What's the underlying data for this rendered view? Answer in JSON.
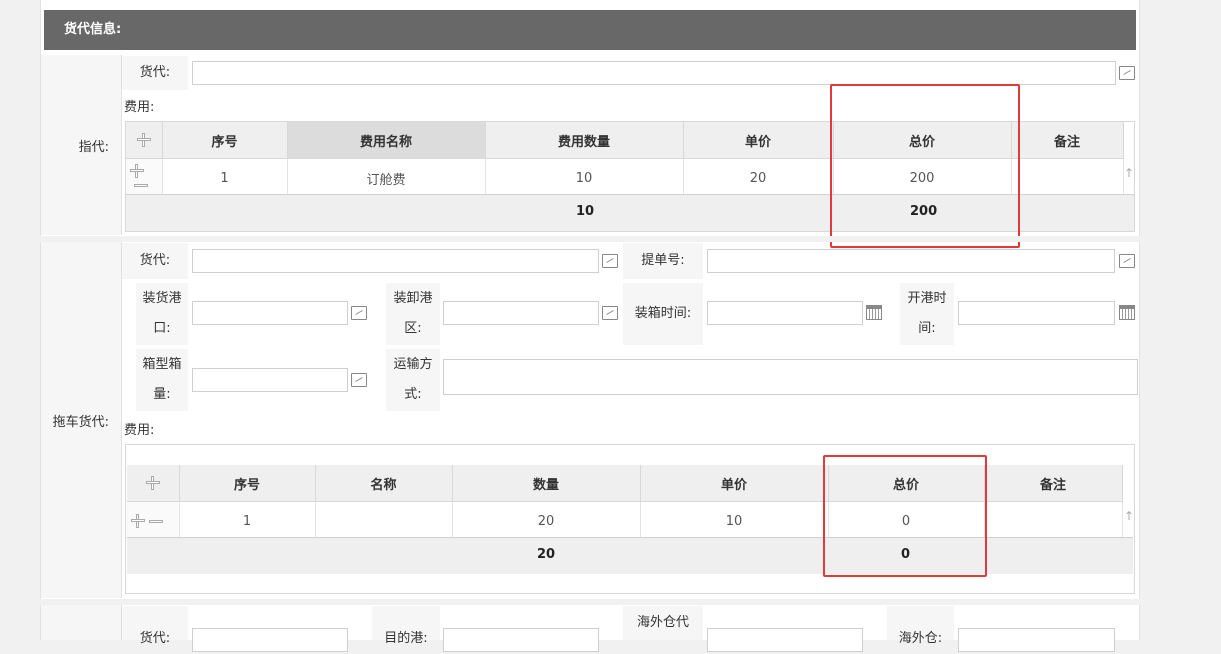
{
  "header": {
    "title": "货代信息:"
  },
  "section1": {
    "label": "指代:",
    "forwarder_label": "货代:",
    "fee_label": "费用:",
    "table": {
      "columns": [
        "序号",
        "费用名称",
        "费用数量",
        "单价",
        "总价",
        "备注"
      ],
      "rows": [
        {
          "no": "1",
          "name": "订舱费",
          "qty": "10",
          "price": "20",
          "total": "200",
          "note": ""
        }
      ],
      "sum_qty": "10",
      "sum_total": "200"
    }
  },
  "section2": {
    "label": "拖车货代:",
    "forwarder_label": "货代:",
    "bill_label": "提单号:",
    "load_port_label": "装货港口:",
    "unload_port_label": "装卸港区:",
    "packing_time_label": "装箱时间:",
    "sail_time_label": "开港时间:",
    "box_label": "箱型箱量:",
    "transport_label": "运输方式:",
    "fee_label": "费用:",
    "table": {
      "columns": [
        "序号",
        "名称",
        "数量",
        "单价",
        "总价",
        "备注"
      ],
      "rows": [
        {
          "no": "1",
          "name": "",
          "qty": "20",
          "price": "10",
          "total": "0",
          "note": ""
        }
      ],
      "sum_qty": "20",
      "sum_total": "0"
    }
  },
  "section3": {
    "forwarder_label": "货代:",
    "dest_label": "目的港:",
    "overseas_label": "海外仓代",
    "overseas2_label": "海外仓:"
  }
}
